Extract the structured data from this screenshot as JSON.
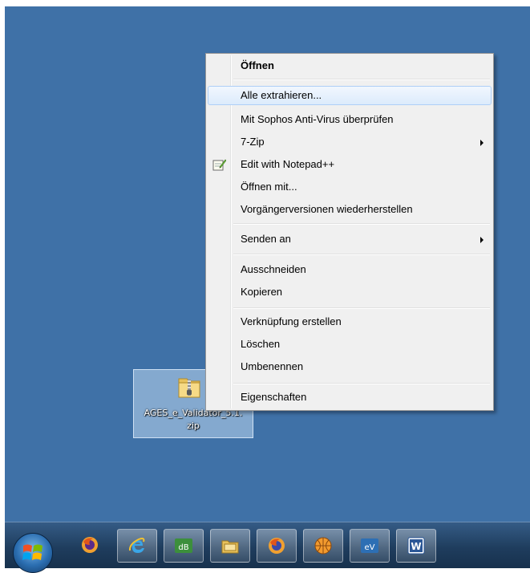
{
  "desktop": {
    "file_icon": {
      "name": "zip-folder-icon",
      "label_line1": "AGES_e_Validator_5.1.",
      "label_line2": "zip"
    }
  },
  "context_menu": {
    "items": [
      {
        "label": "Öffnen",
        "bold": true
      },
      {
        "label": "Alle extrahieren...",
        "hover": true
      },
      {
        "label": "Mit Sophos Anti-Virus überprüfen"
      },
      {
        "label": "7-Zip",
        "submenu": true
      },
      {
        "label": "Edit with Notepad++",
        "icon": "notepad-plus-plus-icon"
      },
      {
        "label": "Öffnen mit..."
      },
      {
        "label": "Vorgängerversionen wiederherstellen"
      },
      {
        "label": "Senden an",
        "submenu": true
      },
      {
        "label": "Ausschneiden"
      },
      {
        "label": "Kopieren"
      },
      {
        "label": "Verknüpfung erstellen"
      },
      {
        "label": "Löschen"
      },
      {
        "label": "Umbenennen"
      },
      {
        "label": "Eigenschaften"
      }
    ]
  },
  "taskbar": {
    "start_icon": "windows-start-orb-icon",
    "apps": [
      {
        "icon": "firefox-icon",
        "pinned": false
      },
      {
        "icon": "internet-explorer-icon",
        "pinned": true
      },
      {
        "icon": "dbase-icon",
        "text": "dB",
        "pinned": true
      },
      {
        "icon": "windows-explorer-icon",
        "pinned": true
      },
      {
        "icon": "firefox-icon",
        "pinned": true
      },
      {
        "icon": "basketball-app-icon",
        "pinned": true
      },
      {
        "icon": "ev-app-icon",
        "text": "eV",
        "pinned": true
      },
      {
        "icon": "microsoft-word-icon",
        "text": "W",
        "pinned": true
      }
    ]
  },
  "colors": {
    "desktop_bg": "#3f71a7",
    "menu_bg": "#f0f0f0",
    "menu_hover": "#dcebfc"
  }
}
